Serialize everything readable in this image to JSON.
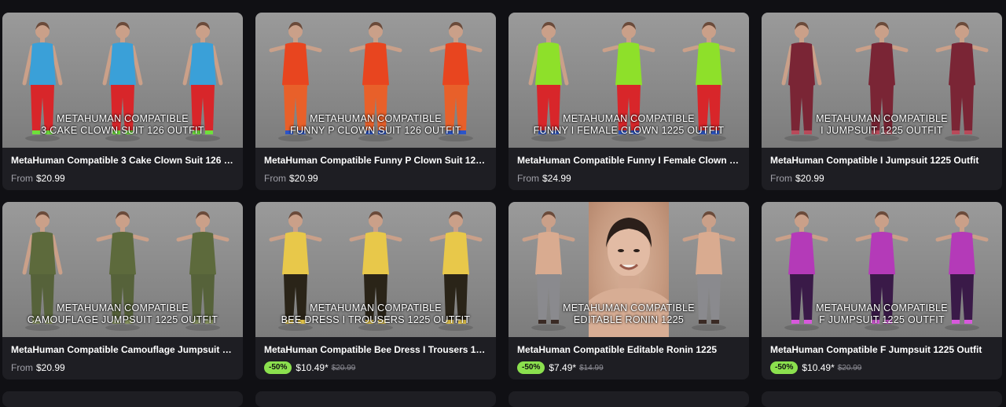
{
  "products": [
    {
      "title": "MetaHuman Compatible 3 Cake Clown Suit 126 O...",
      "overlay_line1": "METAHUMAN COMPATIBLE",
      "overlay_line2": "3 CAKE CLOWN SUIT 126 OUTFIT",
      "from_label": "From",
      "price": "$20.99",
      "colors": {
        "top": "#3aa0d8",
        "bottom": "#d8262a",
        "accent": "#6ee03c"
      }
    },
    {
      "title": "MetaHuman Compatible Funny P Clown Suit 126 ...",
      "overlay_line1": "METAHUMAN COMPATIBLE",
      "overlay_line2": "FUNNY P CLOWN SUIT 126 OUTFIT",
      "from_label": "From",
      "price": "$20.99",
      "colors": {
        "top": "#e8451f",
        "bottom": "#e8602a",
        "accent": "#2c55c8"
      }
    },
    {
      "title": "MetaHuman Compatible Funny I Female Clown 12...",
      "overlay_line1": "METAHUMAN COMPATIBLE",
      "overlay_line2": "FUNNY I FEMALE CLOWN 1225 OUTFIT",
      "from_label": "From",
      "price": "$24.99",
      "colors": {
        "top": "#8ee02a",
        "bottom": "#d8262a",
        "accent": "#2c55c8"
      }
    },
    {
      "title": "MetaHuman Compatible I Jumpsuit 1225 Outfit",
      "overlay_line1": "METAHUMAN COMPATIBLE",
      "overlay_line2": "I JUMPSUIT 1225 OUTFIT",
      "from_label": "From",
      "price": "$20.99",
      "colors": {
        "top": "#7a2535",
        "bottom": "#7a2535",
        "accent": "#b84a5a"
      }
    },
    {
      "title": "MetaHuman Compatible Camouflage Jumpsuit 1...",
      "overlay_line1": "METAHUMAN COMPATIBLE",
      "overlay_line2": "CAMOUFLAGE JUMPSUIT 1225 OUTFIT",
      "from_label": "From",
      "price": "$20.99",
      "colors": {
        "top": "#5d6a3c",
        "bottom": "#56623a",
        "accent": "#8a9660"
      }
    },
    {
      "title": "MetaHuman Compatible Bee Dress I Trousers 122...",
      "overlay_line1": "METAHUMAN COMPATIBLE",
      "overlay_line2": "BEE DRESS I TROUSERS 1225 OUTFIT",
      "discount": "-50%",
      "price": "$10.49*",
      "old_price": "$20.99",
      "colors": {
        "top": "#e8c84a",
        "bottom": "#2a2418",
        "accent": "#e8c84a"
      }
    },
    {
      "title": "MetaHuman Compatible Editable Ronin 1225",
      "overlay_line1": "METAHUMAN COMPATIBLE",
      "overlay_line2": "EDITABLE RONIN 1225",
      "discount": "-50%",
      "price": "$7.49*",
      "old_price": "$14.99",
      "colors": {
        "top": "#d9ab90",
        "bottom": "#8a8a8e",
        "accent": "#3a2a24"
      }
    },
    {
      "title": "MetaHuman Compatible F Jumpsuit 1225 Outfit",
      "overlay_line1": "METAHUMAN COMPATIBLE",
      "overlay_line2": "F JUMPSUIT 1225 OUTFIT",
      "discount": "-50%",
      "price": "$10.49*",
      "old_price": "$20.99",
      "colors": {
        "top": "#b43ab8",
        "bottom": "#3a1a48",
        "accent": "#d858dc"
      }
    }
  ]
}
